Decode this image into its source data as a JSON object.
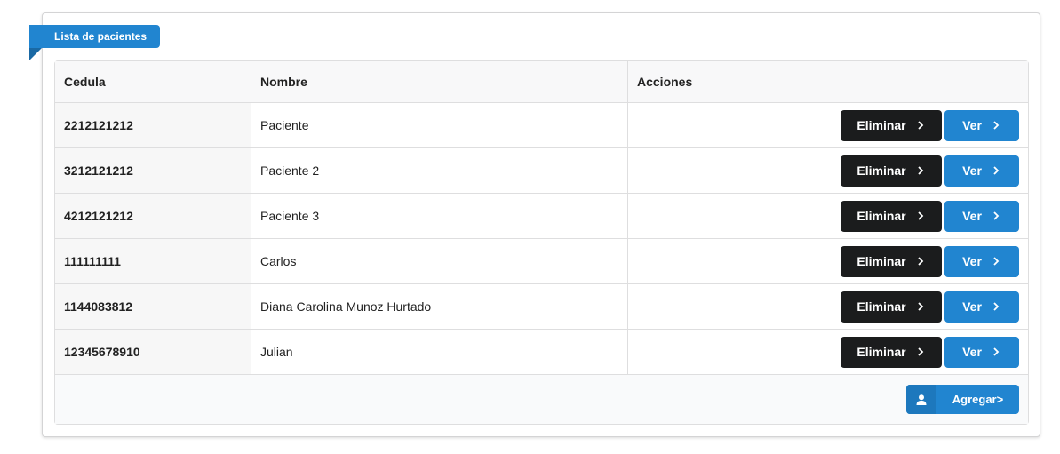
{
  "ribbon": {
    "label": "Lista de pacientes"
  },
  "table": {
    "headers": [
      "Cedula",
      "Nombre",
      "Acciones"
    ],
    "rows": [
      {
        "cedula": "2212121212",
        "nombre": "Paciente"
      },
      {
        "cedula": "3212121212",
        "nombre": "Paciente 2"
      },
      {
        "cedula": "4212121212",
        "nombre": "Paciente 3"
      },
      {
        "cedula": "111111111",
        "nombre": "Carlos"
      },
      {
        "cedula": "1144083812",
        "nombre": "Diana Carolina Munoz Hurtado"
      },
      {
        "cedula": "12345678910",
        "nombre": "Julian"
      }
    ],
    "delete_label": "Eliminar",
    "view_label": "Ver"
  },
  "footer": {
    "add_label": "Agregar>"
  },
  "icons": {
    "chevron": "chevron-right-icon",
    "user": "user-icon"
  },
  "colors": {
    "primary": "#2185d0",
    "dark": "#1b1c1d"
  }
}
